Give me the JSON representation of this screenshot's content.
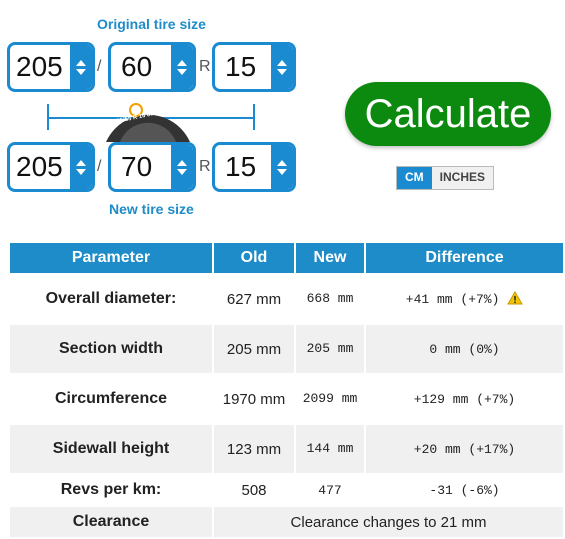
{
  "original": {
    "label": "Original tire size",
    "width": "205",
    "ratio": "60",
    "r_label": "R",
    "rim": "15",
    "slash": "/"
  },
  "new_tire": {
    "label": "New tire size",
    "width": "205",
    "ratio": "70",
    "r_label": "R",
    "rim": "15",
    "slash": "/"
  },
  "tire_image_text": "195/55 R 16 87V",
  "calculate_label": "Calculate",
  "units": {
    "cm": "CM",
    "inches": "INCHES",
    "selected": "CM"
  },
  "table": {
    "headers": [
      "Parameter",
      "Old",
      "New",
      "Difference"
    ],
    "rows": [
      {
        "param": "Overall diameter:",
        "old": "627 mm",
        "new": "668 mm",
        "diff": "+41 mm (+7%)",
        "warning": true
      },
      {
        "param": "Section width",
        "old": "205 mm",
        "new": "205 mm",
        "diff": "0 mm (0%)"
      },
      {
        "param": "Circumference",
        "old": "1970 mm",
        "new": "2099 mm",
        "diff": "+129 mm (+7%)"
      },
      {
        "param": "Sidewall height",
        "old": "123 mm",
        "new": "144 mm",
        "diff": "+20 mm (+17%)"
      },
      {
        "param": "Revs per km:",
        "old": "508",
        "new": "477",
        "diff": "-31 (-6%)"
      }
    ],
    "clearance": {
      "param": "Clearance",
      "text": "Clearance changes to 21 mm"
    }
  },
  "colors": {
    "accent": "#1a8bd0",
    "calculate": "#0b8a0f",
    "warning": "#f5c400"
  }
}
